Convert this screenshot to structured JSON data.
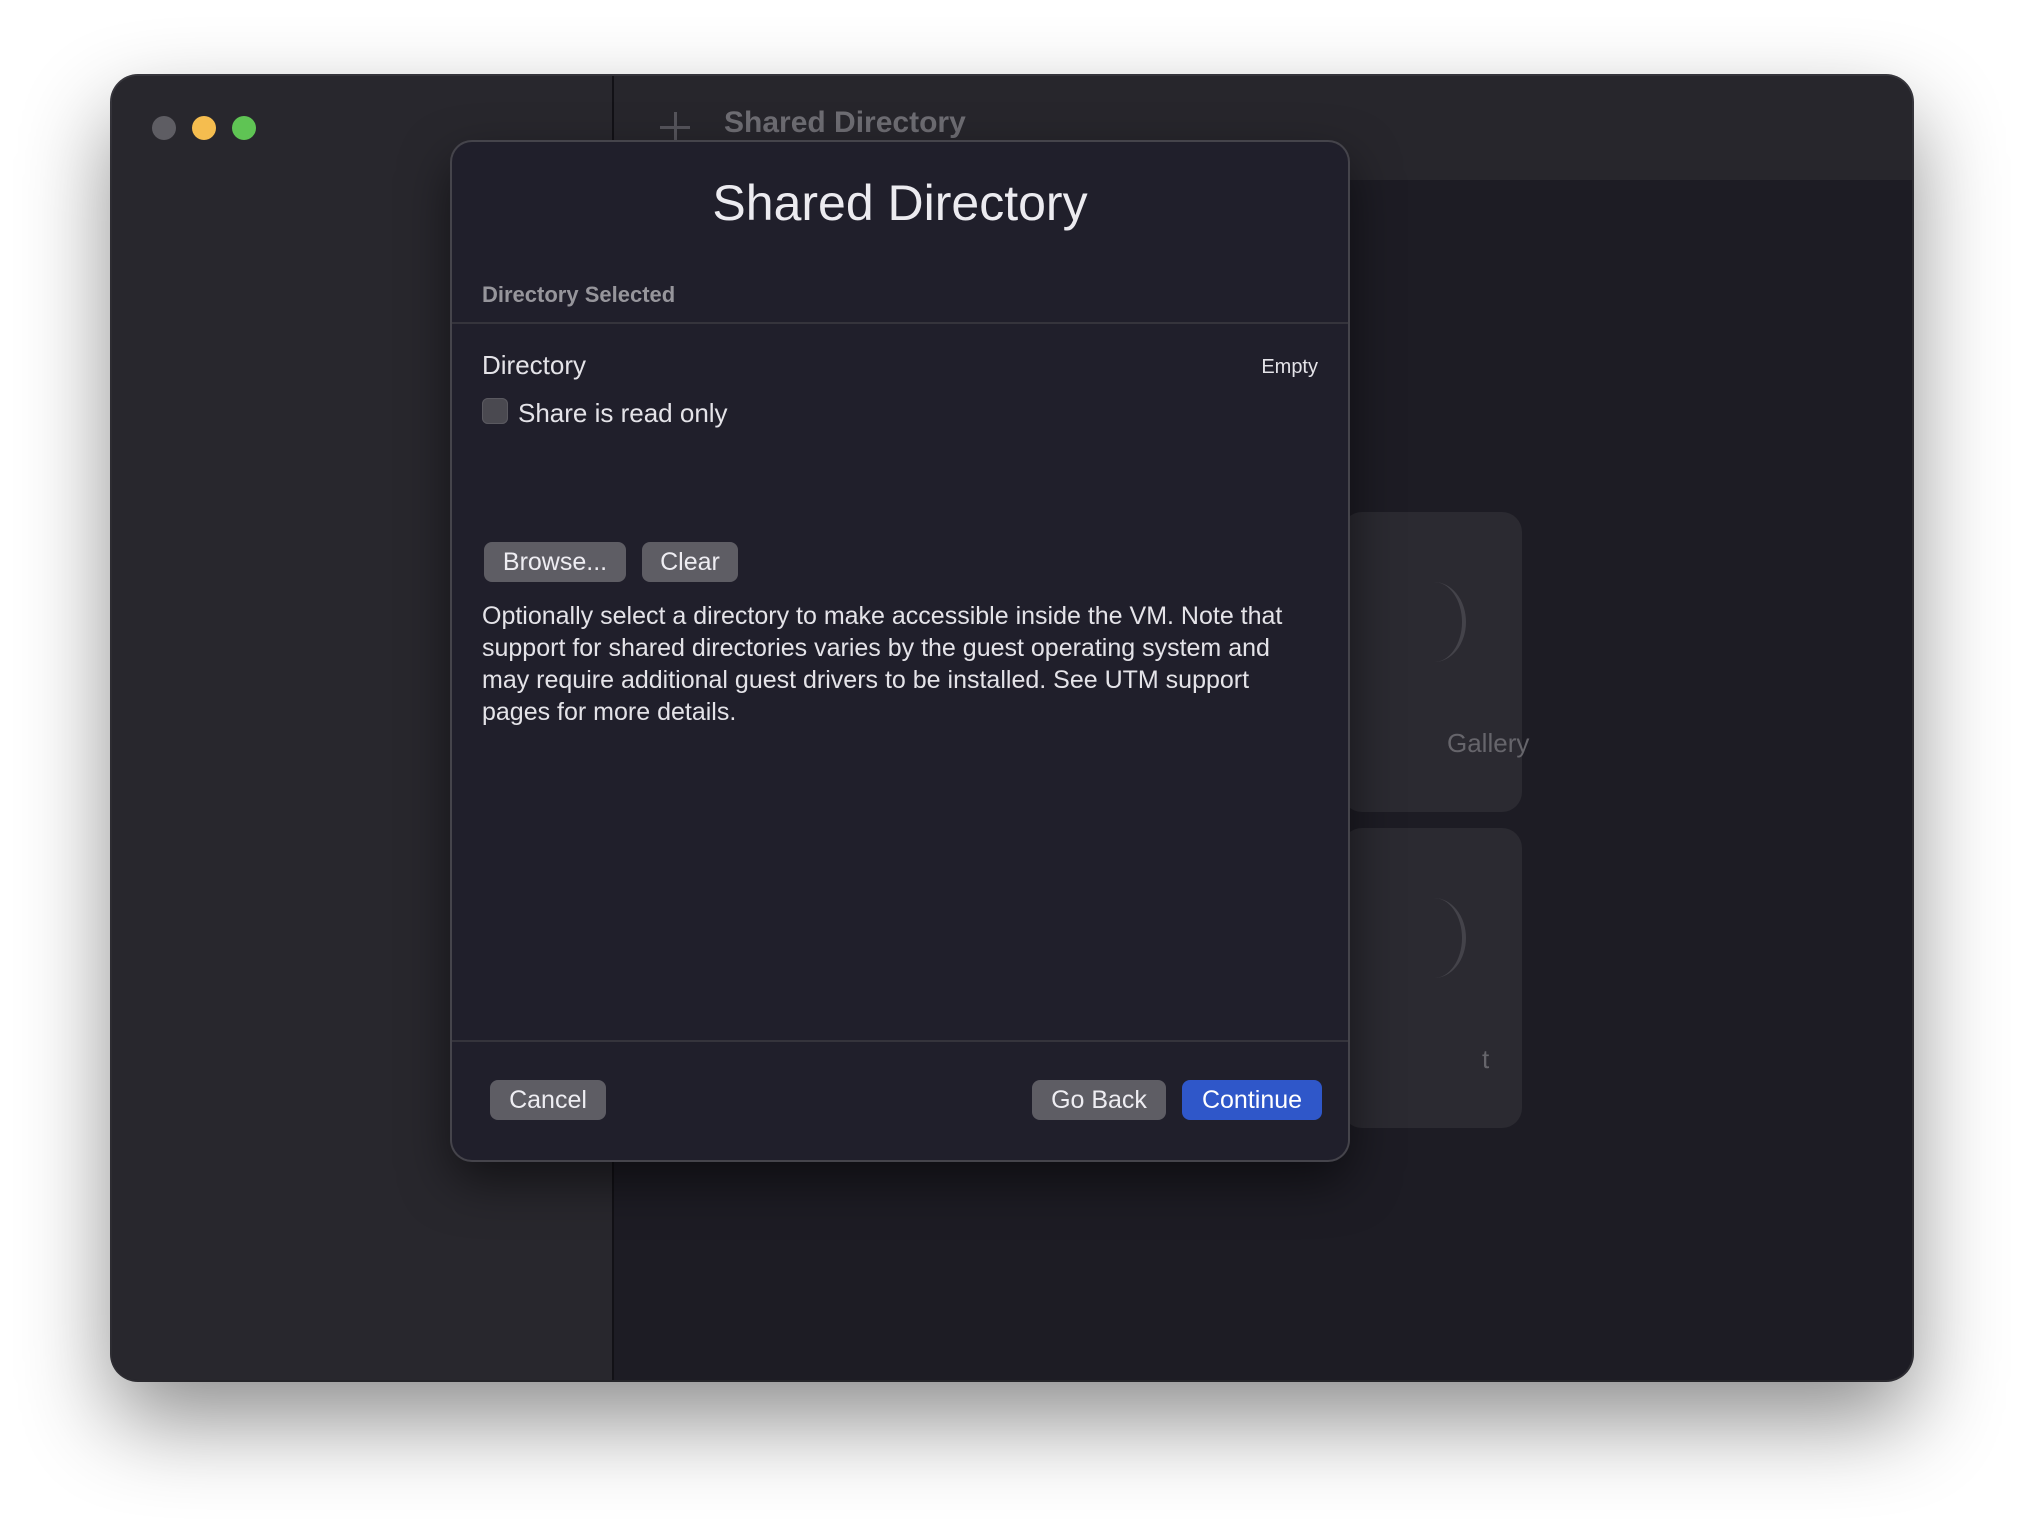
{
  "window": {
    "toolbar_title": "Shared Directory"
  },
  "background": {
    "card1_label": "Gallery",
    "card2_label": "t"
  },
  "dialog": {
    "title": "Shared Directory",
    "section_header": "Directory Selected",
    "directory_label": "Directory",
    "directory_value": "Empty",
    "read_only_label": "Share is read only",
    "read_only_checked": false,
    "browse_label": "Browse...",
    "clear_label": "Clear",
    "description": "Optionally select a directory to make accessible inside the VM. Note that support for shared directories varies by the guest operating system and may require additional guest drivers to be installed. See UTM support pages for more details.",
    "cancel_label": "Cancel",
    "go_back_label": "Go Back",
    "continue_label": "Continue"
  },
  "colors": {
    "accent": "#2f57c9",
    "close": "#5e5d63",
    "minimize": "#f5bd4f",
    "maximize": "#5fc454"
  }
}
